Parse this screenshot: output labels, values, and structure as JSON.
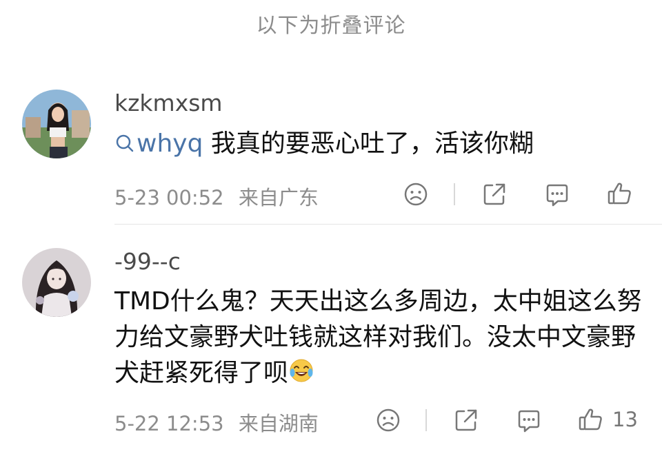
{
  "folded_header": "以下为折叠评论",
  "comments": [
    {
      "username": "kzkmxsm",
      "mention": "whyq",
      "text": "我真的要恶心吐了，活该你糊",
      "timestamp": "5-23 00:52",
      "location": "来自广东",
      "like_count": ""
    },
    {
      "username": "-99--c",
      "text": "TMD什么鬼？天天出这么多周边，太中姐这么努力给文豪野犬吐钱就这样对我们。没太中文豪野犬赶紧死得了呗",
      "emoji": "laughing-crying-emoji",
      "timestamp": "5-22 12:53",
      "location": "来自湖南",
      "like_count": "13"
    }
  ],
  "icons": {
    "dislike": "sad-face-icon",
    "share": "share-icon",
    "comment": "comment-icon",
    "like": "thumbs-up-icon"
  },
  "colors": {
    "mention": "#4a74a8",
    "meta": "#8c8c8c",
    "icon": "#777777"
  }
}
